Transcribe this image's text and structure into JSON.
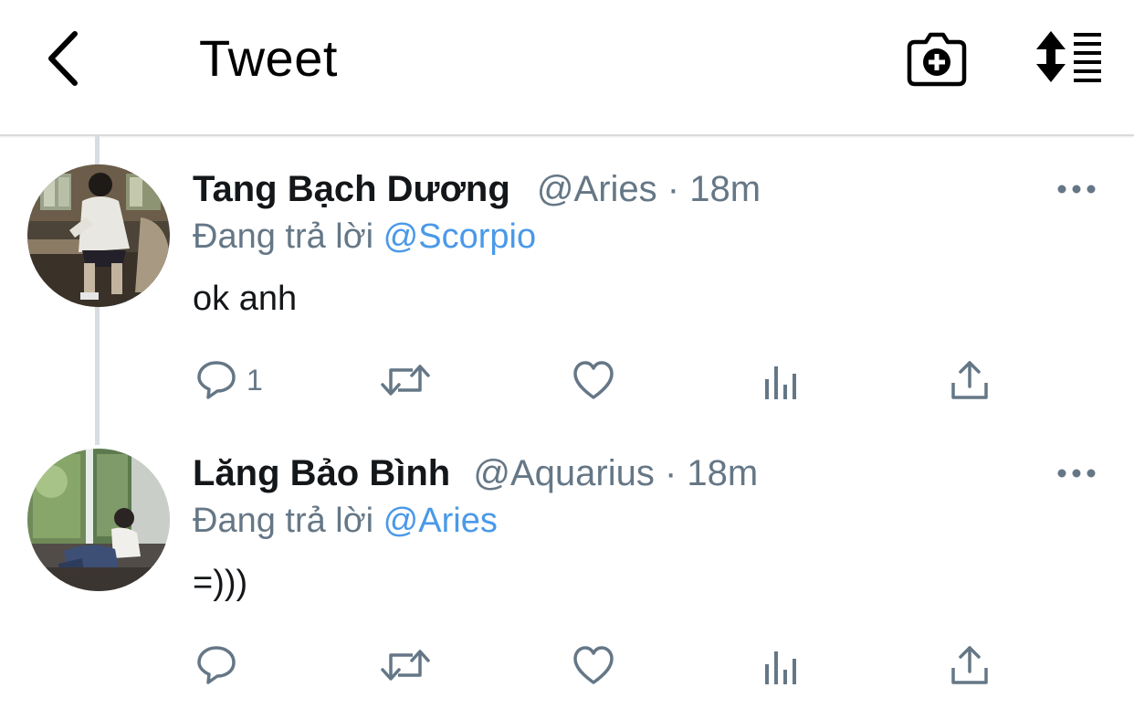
{
  "header": {
    "title": "Tweet",
    "back_icon": "chevron-left-icon",
    "camera_icon": "camera-add-icon",
    "sort_icon": "sort-list-icon"
  },
  "colors": {
    "link": "#4a99e9",
    "muted": "#657786",
    "text": "#14171a",
    "thread_line": "#d8dde1"
  },
  "tweets": [
    {
      "display_name": "Tang Bạch Dương",
      "handle": "@Aries",
      "separator": "·",
      "time": "18m",
      "reply_prefix": "Đang trả lời",
      "reply_to": "@Scorpio",
      "text": "ok anh",
      "reply_count": "1"
    },
    {
      "display_name": "Lăng Bảo Bình",
      "handle": "@Aquarius",
      "separator": "·",
      "time": "18m",
      "reply_prefix": "Đang trả lời",
      "reply_to": "@Aries",
      "text": "=)))",
      "reply_count": ""
    }
  ]
}
